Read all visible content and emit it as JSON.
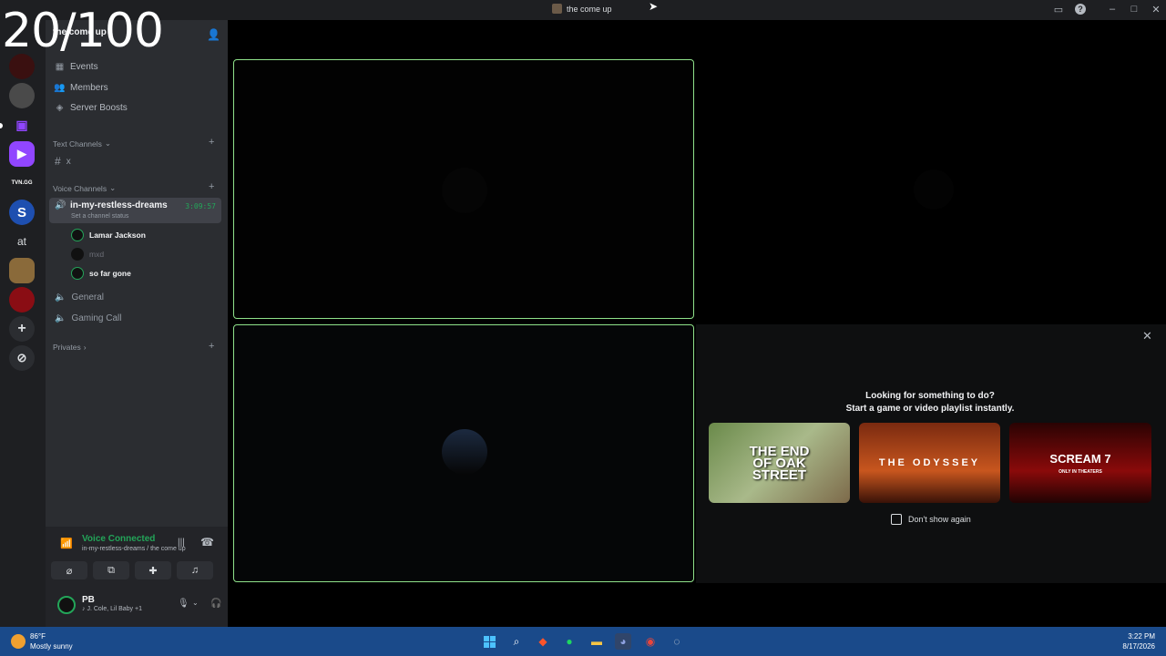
{
  "overlay": {
    "counter": "20/100"
  },
  "window": {
    "title": "the come up",
    "controls": [
      "inbox-icon",
      "help-icon",
      "minimize-icon",
      "maximize-icon",
      "close-icon"
    ]
  },
  "server": {
    "name": "the come up",
    "nav": [
      "Events",
      "Members",
      "Server Boosts"
    ],
    "text_category": "Text Channels",
    "text_channels": [
      "x"
    ],
    "voice_category": "Voice Channels",
    "active_voice": {
      "name": "in-my-restless-dreams",
      "timer": "3:09:57",
      "status": "Set a channel status"
    },
    "voice_users": [
      "Lamar Jackson",
      "mxd",
      "so far gone"
    ],
    "other_voice": [
      "General",
      "Gaming Call"
    ],
    "privates_category": "Privates"
  },
  "guild_rail": {
    "labels": [
      "TVN.GG",
      "S",
      "at"
    ]
  },
  "voice_panel": {
    "status": "Voice Connected",
    "location": "in-my-restless-dreams / the come up",
    "user_name": "PB",
    "user_status": "J. Cole, Lil Baby +1"
  },
  "promo": {
    "line1": "Looking for something to do?",
    "line2": "Start a game or video playlist instantly.",
    "games": [
      "THE END OF OAK STREET",
      "THE ODYSSEY",
      "SCREAM 7"
    ],
    "game_subtext": "ONLY IN THEATERS",
    "checkbox_label": "Don't show again"
  },
  "taskbar": {
    "temp": "86°F",
    "weather": "Mostly sunny",
    "time": "3:22 PM",
    "date": "8/17/2026"
  },
  "colors": {
    "accent_green": "#23a559",
    "tile_border": "#8fe28a",
    "rail_bg": "#1e1f22",
    "sidebar_bg": "#2b2d31"
  }
}
